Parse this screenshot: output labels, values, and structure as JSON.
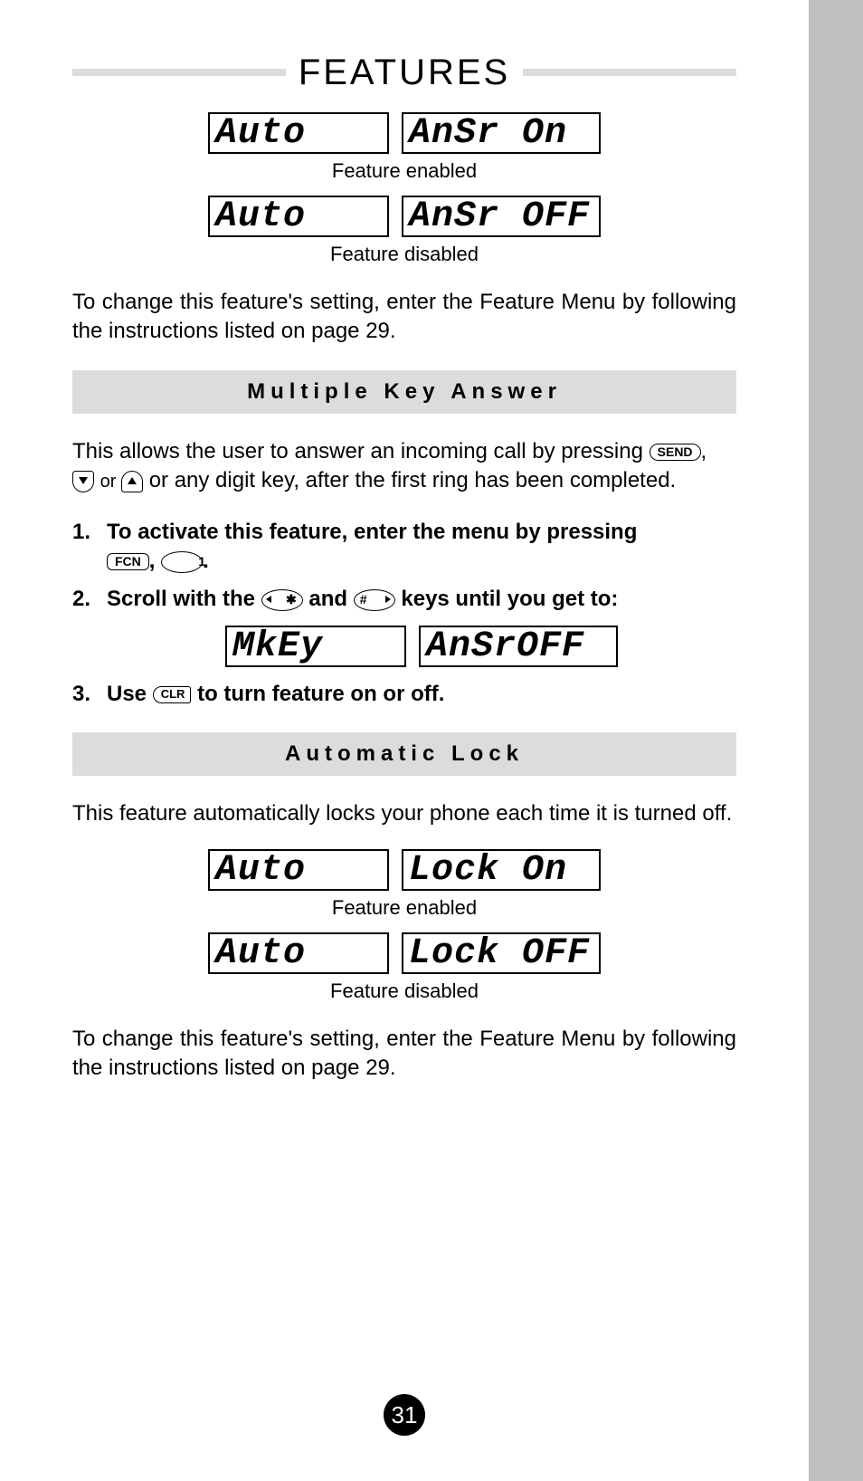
{
  "header": {
    "title": "FEATURES"
  },
  "auto_answer": {
    "enabled_row": {
      "left": "Auto",
      "right": "AnSr On"
    },
    "enabled_caption": "Feature enabled",
    "disabled_row": {
      "left": "Auto",
      "right": "AnSr OFF"
    },
    "disabled_caption": "Feature disabled",
    "change_text": "To change this feature's setting, enter the Feature Menu by following the instructions listed on page 29."
  },
  "mkey": {
    "heading": "Multiple Key Answer",
    "intro_a": "This allows the user to answer an incoming call by pressing ",
    "intro_b": " or ",
    "intro_c": " or any digit key, after the first ring has been completed.",
    "step1_a": "To activate this feature, enter the menu by pressing ",
    "step1_comma": ", ",
    "step1_end": ".",
    "step2_a": "Scroll with the ",
    "step2_b": " and ",
    "step2_c": " keys until you get to:",
    "display": {
      "left": "MkEy",
      "right": "AnSrOFF"
    },
    "step3_a": "Use ",
    "step3_b": " to turn feature on or off."
  },
  "autolock": {
    "heading": "Automatic Lock",
    "intro": "This feature automatically locks your phone each time it is turned off.",
    "enabled_row": {
      "left": "Auto",
      "right": "Lock On"
    },
    "enabled_caption": "Feature enabled",
    "disabled_row": {
      "left": "Auto",
      "right": "Lock OFF"
    },
    "disabled_caption": "Feature disabled",
    "change_text": "To change this feature's setting, enter the Feature Menu by following the instructions listed on page 29."
  },
  "keys": {
    "send": "SEND",
    "fcn": "FCN",
    "one": "1",
    "star": "✱",
    "hash": "#",
    "clr": "CLR",
    "or": "or"
  },
  "page_number": "31"
}
